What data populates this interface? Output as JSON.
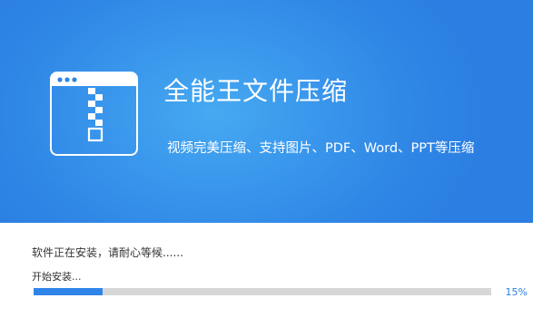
{
  "banner": {
    "title": "全能王文件压缩",
    "tagline": "视频完美压缩、支持图片、PDF、Word、PPT等压缩",
    "logo_icon": "zip-file-window-icon",
    "colors": {
      "banner_dark": "#2b7fe2",
      "banner_light": "#46a9f1"
    }
  },
  "install": {
    "status_message": "软件正在安装，请耐心等候......",
    "progress_label": "开始安装...",
    "progress_value": 0.15,
    "progress_percent_text": "15%",
    "colors": {
      "progress_fill": "#2f84e8",
      "progress_track": "#d7d7d7"
    }
  }
}
